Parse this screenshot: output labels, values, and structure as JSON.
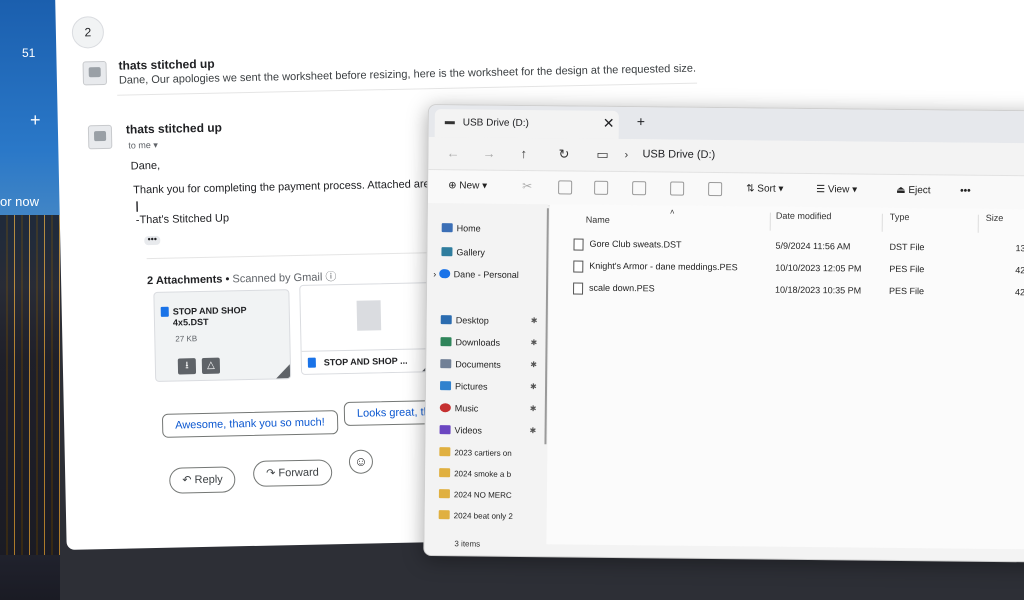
{
  "desktop": {
    "count": "51",
    "plus": "+",
    "now_label": "or now"
  },
  "mail": {
    "thread_count": "2",
    "msg1": {
      "sender": "thats stitched up",
      "snippet": "Dane, Our apologies we sent the worksheet before resizing, here is the worksheet for the design at the requested size."
    },
    "msg2": {
      "sender": "thats stitched up",
      "to": "to me ▾",
      "greeting": "Dane,",
      "body": "Thank you for completing the payment process. Attached are the",
      "cursor": "|",
      "signature": "-That's Stitched Up",
      "more": "•••"
    },
    "attachments": {
      "header": "2 Attachments",
      "scanned": "Scanned by Gmail ⓘ",
      "dot": "•",
      "items": [
        {
          "name_line1": "STOP AND SHOP",
          "name_line2": "4x5.DST",
          "size": "27 KB"
        },
        {
          "label": "STOP AND SHOP ..."
        }
      ]
    },
    "smart_replies": [
      "Awesome, thank you so much!",
      "Looks great, thank"
    ],
    "actions": {
      "reply": "Reply",
      "forward": "Forward",
      "emoji": "☺"
    }
  },
  "explorer": {
    "tab_title": "USB Drive (D:)",
    "tab_close": "✕",
    "new_tab": "+",
    "breadcrumb": "USB Drive (D:)",
    "toolbar": {
      "new": "New",
      "sort": "Sort",
      "view": "View",
      "eject": "Eject",
      "more": "•••"
    },
    "sidebar": {
      "home": "Home",
      "gallery": "Gallery",
      "personal": "Dane - Personal",
      "pinned": [
        "Desktop",
        "Downloads",
        "Documents",
        "Pictures",
        "Music",
        "Videos"
      ],
      "folders": [
        "2023 cartiers on",
        "2024 smoke a b",
        "2024 NO MERC",
        "2024 beat only 2"
      ]
    },
    "columns": {
      "name": "Name",
      "date": "Date modified",
      "type": "Type",
      "size": "Size"
    },
    "files": [
      {
        "name": "Gore Club sweats.DST",
        "date": "5/9/2024 11:56 AM",
        "type": "DST File",
        "size": "13"
      },
      {
        "name": "Knight's Armor - dane meddings.PES",
        "date": "10/10/2023 12:05 PM",
        "type": "PES File",
        "size": "42"
      },
      {
        "name": "scale down.PES",
        "date": "10/18/2023 10:35 PM",
        "type": "PES File",
        "size": "42"
      }
    ],
    "status": "3 items"
  }
}
